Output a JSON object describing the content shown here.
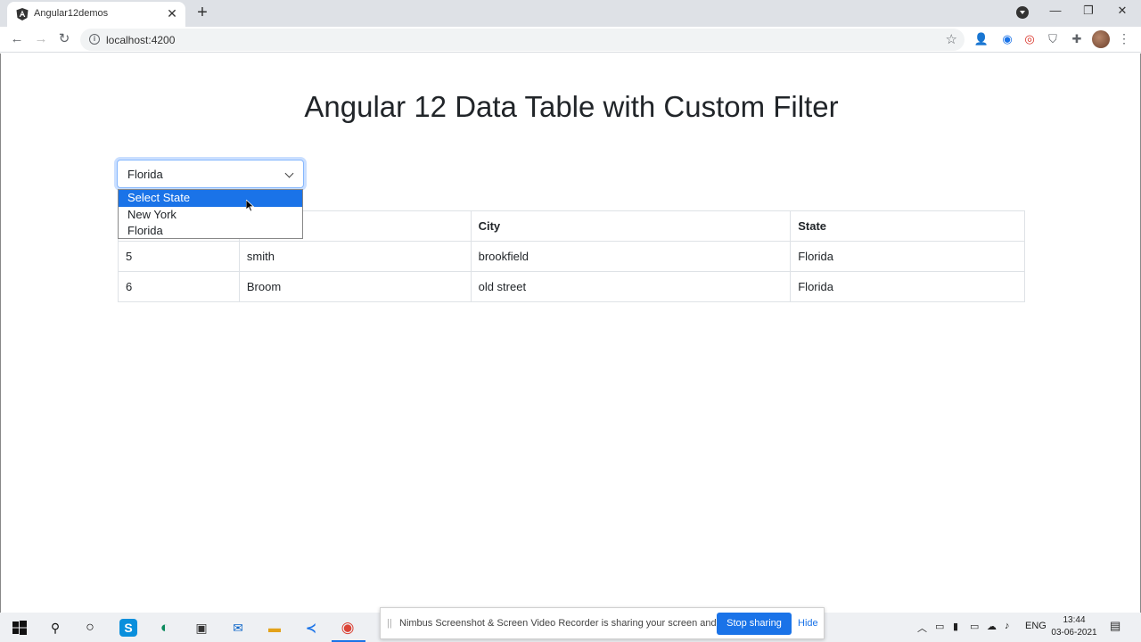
{
  "browser": {
    "tab_title": "Angular12demos",
    "url": "localhost:4200",
    "tab_close": "✕",
    "new_tab": "+",
    "minimize": "—",
    "restore": "❐",
    "close": "✕"
  },
  "page": {
    "heading": "Angular 12 Data Table with Custom Filter",
    "state_select": {
      "value": "Florida",
      "options": [
        "Select State",
        "New York",
        "Florida"
      ],
      "highlighted_option": "Select State"
    },
    "table": {
      "headers": [
        "",
        "",
        "City",
        "State"
      ],
      "rows": [
        [
          "5",
          "smith",
          "brookfield",
          "Florida"
        ],
        [
          "6",
          "Broom",
          "old street",
          "Florida"
        ]
      ]
    }
  },
  "share_bar": {
    "grip": "||",
    "message": "Nimbus Screenshot & Screen Video Recorder is sharing your screen and audio.",
    "stop_label": "Stop sharing",
    "hide_label": "Hide"
  },
  "taskbar": {
    "language": "ENG",
    "time": "13:44",
    "date": "03-06-2021"
  },
  "colors": {
    "accent": "#1a73e8",
    "focus_border": "#86b7fe"
  }
}
